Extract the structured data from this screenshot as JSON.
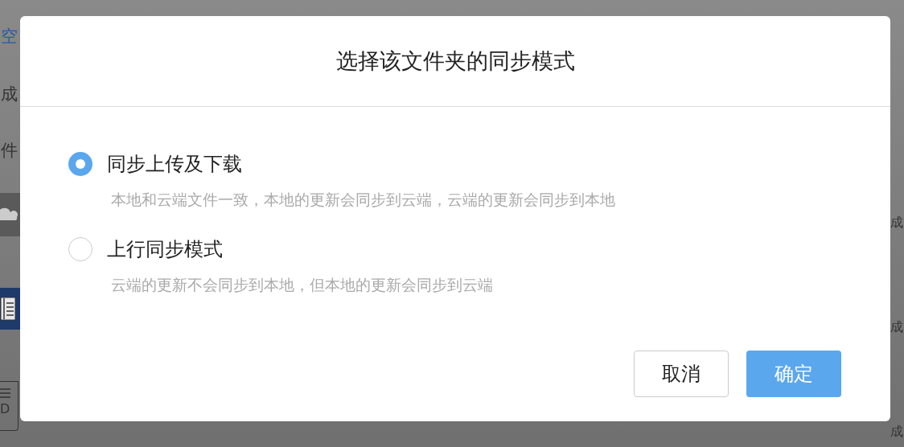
{
  "background": {
    "left": [
      {
        "kind": "link",
        "text": "空"
      },
      {
        "kind": "text",
        "text": "成"
      },
      {
        "kind": "text",
        "text": "件"
      },
      {
        "kind": "cloud"
      },
      {
        "kind": "document"
      },
      {
        "kind": "file",
        "text": "D"
      }
    ],
    "right": [
      "成",
      "成",
      "成"
    ]
  },
  "dialog": {
    "title": "选择该文件夹的同步模式",
    "options": [
      {
        "label": "同步上传及下载",
        "description": "本地和云端文件一致，本地的更新会同步到云端，云端的更新会同步到本地",
        "selected": true
      },
      {
        "label": "上行同步模式",
        "description": "云端的更新不会同步到本地，但本地的更新会同步到云端",
        "selected": false
      }
    ],
    "buttons": [
      {
        "label": "取消",
        "kind": "secondary"
      },
      {
        "label": "确定",
        "kind": "primary"
      }
    ]
  }
}
